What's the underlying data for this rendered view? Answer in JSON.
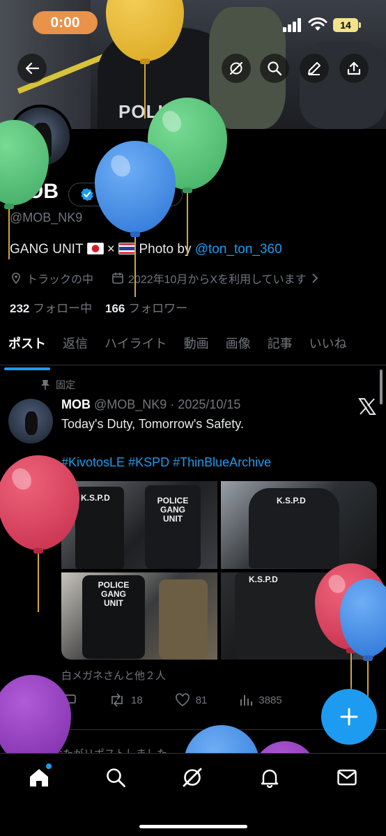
{
  "status": {
    "time": "0:00",
    "battery": "14"
  },
  "header": {
    "icons": [
      "back-arrow-icon",
      "grok-icon",
      "search-icon",
      "edit-icon",
      "share-icon"
    ]
  },
  "profile": {
    "name": "MOB",
    "verify_label": "認証を受ける",
    "handle": "@MOB_NK9",
    "bio_prefix": "GANG UNIT ",
    "bio_mid": "×",
    "bio_photo": "Photo by ",
    "bio_link": "@ton_ton_360",
    "location": "トラックの中",
    "joined": "2022年10月からXを利用しています",
    "following_count": "232",
    "following_label": "フォロー中",
    "followers_count": "166",
    "followers_label": "フォロワー"
  },
  "tabs": [
    "ポスト",
    "返信",
    "ハイライト",
    "動画",
    "画像",
    "記事",
    "いいね"
  ],
  "post": {
    "pinned_label": "固定",
    "author": "MOB",
    "handle_date": "@MOB_NK9 · 2025/10/15",
    "text": "Today's Duty, Tomorrow's Safety.",
    "hashtags": "#KivotosLE #KSPD #ThinBlueArchive",
    "liked_by": "白メガネさんと他２人",
    "reposts": "18",
    "likes": "81",
    "views": "3885",
    "photo_texts": [
      "K.S.P.D",
      "POLICE GANG UNIT",
      "K.S.P.D",
      "POLICE GANG UNIT",
      "K.S.P.D"
    ]
  },
  "next_post_text": "あなたがリポストしました",
  "colors": {
    "accent": "#1d9bf0",
    "background": "#000000",
    "muted": "#71767b"
  }
}
